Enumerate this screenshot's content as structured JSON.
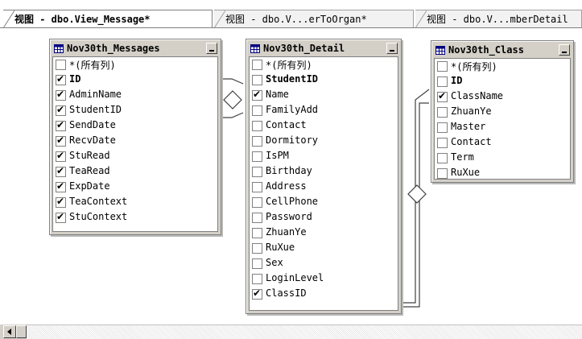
{
  "tabs": [
    {
      "label": "视图 - dbo.View_Message*",
      "active": true
    },
    {
      "label": "视图 - dbo.V...erToOrgan*",
      "active": false
    },
    {
      "label": "视图 - dbo.V...mberDetail",
      "active": false
    }
  ],
  "tables": [
    {
      "name": "Nov30th_Messages",
      "rows": [
        {
          "label": "*(所有列)",
          "checked": false,
          "pk": false
        },
        {
          "label": "ID",
          "checked": true,
          "pk": true
        },
        {
          "label": "AdminName",
          "checked": true,
          "pk": false
        },
        {
          "label": "StudentID",
          "checked": true,
          "pk": false
        },
        {
          "label": "SendDate",
          "checked": true,
          "pk": false
        },
        {
          "label": "RecvDate",
          "checked": true,
          "pk": false
        },
        {
          "label": "StuRead",
          "checked": true,
          "pk": false
        },
        {
          "label": "TeaRead",
          "checked": true,
          "pk": false
        },
        {
          "label": "ExpDate",
          "checked": true,
          "pk": false
        },
        {
          "label": "TeaContext",
          "checked": true,
          "pk": false
        },
        {
          "label": "StuContext",
          "checked": true,
          "pk": false
        }
      ]
    },
    {
      "name": "Nov30th_Detail",
      "rows": [
        {
          "label": "*(所有列)",
          "checked": false,
          "pk": false
        },
        {
          "label": "StudentID",
          "checked": false,
          "pk": true
        },
        {
          "label": "Name",
          "checked": true,
          "pk": false
        },
        {
          "label": "FamilyAdd",
          "checked": false,
          "pk": false
        },
        {
          "label": "Contact",
          "checked": false,
          "pk": false
        },
        {
          "label": "Dormitory",
          "checked": false,
          "pk": false
        },
        {
          "label": "IsPM",
          "checked": false,
          "pk": false
        },
        {
          "label": "Birthday",
          "checked": false,
          "pk": false
        },
        {
          "label": "Address",
          "checked": false,
          "pk": false
        },
        {
          "label": "CellPhone",
          "checked": false,
          "pk": false
        },
        {
          "label": "Password",
          "checked": false,
          "pk": false
        },
        {
          "label": "ZhuanYe",
          "checked": false,
          "pk": false
        },
        {
          "label": "RuXue",
          "checked": false,
          "pk": false
        },
        {
          "label": "Sex",
          "checked": false,
          "pk": false
        },
        {
          "label": "LoginLevel",
          "checked": false,
          "pk": false
        },
        {
          "label": "ClassID",
          "checked": true,
          "pk": false
        }
      ]
    },
    {
      "name": "Nov30th_Class",
      "rows": [
        {
          "label": "*(所有列)",
          "checked": false,
          "pk": false
        },
        {
          "label": "ID",
          "checked": false,
          "pk": true
        },
        {
          "label": "ClassName",
          "checked": true,
          "pk": false
        },
        {
          "label": "ZhuanYe",
          "checked": false,
          "pk": false
        },
        {
          "label": "Master",
          "checked": false,
          "pk": false
        },
        {
          "label": "Contact",
          "checked": false,
          "pk": false
        },
        {
          "label": "Term",
          "checked": false,
          "pk": false
        },
        {
          "label": "RuXue",
          "checked": false,
          "pk": false
        }
      ]
    }
  ],
  "icons": {
    "table": "table-grid-icon",
    "minimize": "minimize-button",
    "join": "join-diamond-icon",
    "scroll_left": "arrow-left-icon"
  }
}
